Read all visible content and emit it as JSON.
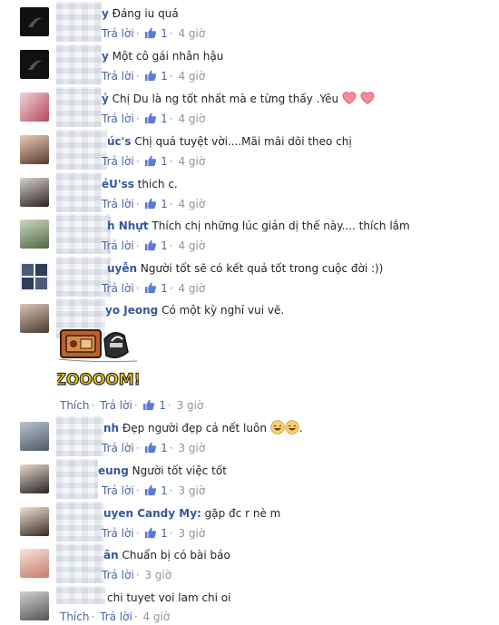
{
  "comments": [
    {
      "name": "y",
      "text": "Đáng iu quá",
      "reply": "Trả lời",
      "likes": "1",
      "time": "4 giờ"
    },
    {
      "name": "y",
      "text": "Một cô gái nhân hậu",
      "reply": "Trả lời",
      "likes": "1",
      "time": "4 giờ"
    },
    {
      "name": "ỷ",
      "text": "Chị Du là ng tốt nhất mà e từng thấy .Yêu",
      "reply": "Trả lời",
      "likes": "1",
      "time": "4 giờ"
    },
    {
      "name": "úc's",
      "text": "Chị quá tuyệt vời....Mãi mãi dõi theo chị",
      "reply": "Trả lời",
      "likes": "1",
      "time": "4 giờ"
    },
    {
      "name": "ẻU'ss",
      "text": "thich c.",
      "reply": "Trả lời",
      "likes": "1",
      "time": "4 giờ"
    },
    {
      "name": "h Nhựt",
      "text": "Thích chị những lúc giản dị thế này.... thích lắm",
      "reply": "Trả lời",
      "likes": "1",
      "time": "4 giờ"
    },
    {
      "name": "uyễn",
      "text": "Người tốt sẽ có kết quả tốt trong cuộc đời :))",
      "reply": "Trả lời",
      "likes": "1",
      "time": "4 giờ"
    },
    {
      "name": "yo Jeong",
      "text": "Có một kỳ nghỉ vui vẽ.",
      "like_action": "Thích",
      "reply": "Trả lời",
      "likes": "1",
      "time": "3 giờ",
      "sticker_text": "ZOOOOM!"
    },
    {
      "name": "nh",
      "text": "Đẹp người đẹp cả nết luôn",
      "reply": "Trả lời",
      "likes": "1",
      "time": "3 giờ"
    },
    {
      "name": "eung",
      "text": "Người tốt việc tốt",
      "reply": "Trả lời",
      "likes": "1",
      "time": "3 giờ"
    },
    {
      "name": "uyen Candy My:",
      "text": "gặp đc r nè m",
      "reply": "Trả lời",
      "likes": "1",
      "time": "3 giờ"
    },
    {
      "name": "ân",
      "text": "Chuẩn bị có bài báo",
      "reply": "Trả lời",
      "time": "3 giờ"
    },
    {
      "name": "",
      "text": "chi tuyet voi lam chi oi",
      "like_action": "Thích",
      "reply": "Trả lời",
      "time": "4 giờ"
    }
  ],
  "colors": {
    "link": "#365899",
    "meta": "#90949c",
    "action": "#4b67a1",
    "heart": "#f25268"
  }
}
